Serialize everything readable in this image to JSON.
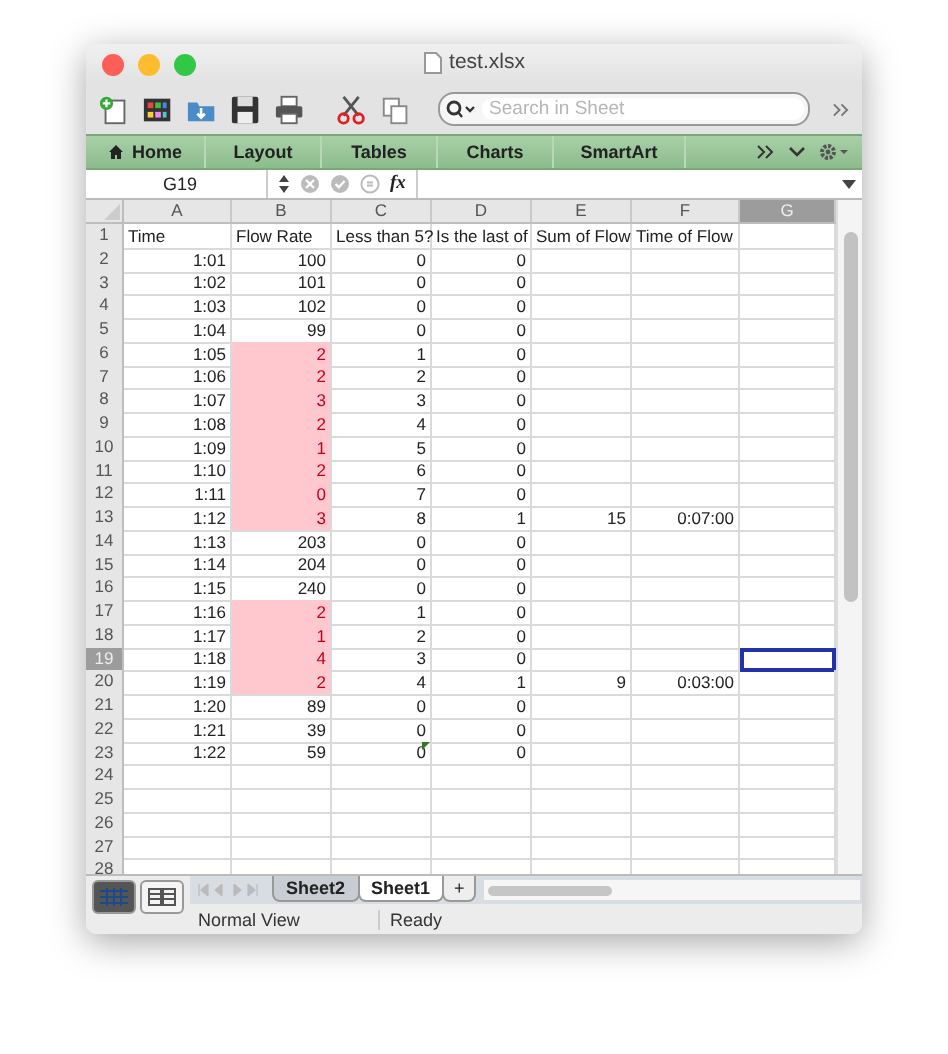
{
  "window": {
    "title": "test.xlsx"
  },
  "toolbar": {
    "search": {
      "placeholder": "Search in Sheet"
    }
  },
  "ribbon_tabs": [
    {
      "label": "Home",
      "kind": "home"
    },
    {
      "label": "Layout",
      "kind": "plain"
    },
    {
      "label": "Tables",
      "kind": "plain"
    },
    {
      "label": "Charts",
      "kind": "plain"
    },
    {
      "label": "SmartArt",
      "kind": "plain"
    }
  ],
  "formula_bar": {
    "name_box": "G19",
    "fx": "fx"
  },
  "columns": [
    {
      "label": "A",
      "selected": false
    },
    {
      "label": "B",
      "selected": false
    },
    {
      "label": "C",
      "selected": false
    },
    {
      "label": "D",
      "selected": false
    },
    {
      "label": "E",
      "selected": false
    },
    {
      "label": "F",
      "selected": false
    },
    {
      "label": "G",
      "selected": true
    }
  ],
  "rows": [
    {
      "number": "1",
      "kind": "text",
      "cells": [
        "Time",
        "Flow Rate",
        "Less than 5?",
        "Is the last of",
        "Sum of Flow",
        "Time of Flow"
      ],
      "flagged": false,
      "warning": false,
      "selected": false
    },
    {
      "number": "2",
      "kind": "number",
      "cells": [
        "1:01",
        "100",
        "0",
        "0"
      ],
      "flagged": false,
      "warning": false,
      "selected": false
    },
    {
      "number": "3",
      "kind": "number",
      "cells": [
        "1:02",
        "101",
        "0",
        "0"
      ],
      "flagged": false,
      "warning": false,
      "selected": false
    },
    {
      "number": "4",
      "kind": "number",
      "cells": [
        "1:03",
        "102",
        "0",
        "0"
      ],
      "flagged": false,
      "warning": false,
      "selected": false
    },
    {
      "number": "5",
      "kind": "number",
      "cells": [
        "1:04",
        "99",
        "0",
        "0"
      ],
      "flagged": false,
      "warning": false,
      "selected": false
    },
    {
      "number": "6",
      "kind": "number",
      "cells": [
        "1:05",
        "2",
        "1",
        "0"
      ],
      "flagged": true,
      "warning": false,
      "selected": false
    },
    {
      "number": "7",
      "kind": "number",
      "cells": [
        "1:06",
        "2",
        "2",
        "0"
      ],
      "flagged": true,
      "warning": false,
      "selected": false
    },
    {
      "number": "8",
      "kind": "number",
      "cells": [
        "1:07",
        "3",
        "3",
        "0"
      ],
      "flagged": true,
      "warning": false,
      "selected": false
    },
    {
      "number": "9",
      "kind": "number",
      "cells": [
        "1:08",
        "2",
        "4",
        "0"
      ],
      "flagged": true,
      "warning": false,
      "selected": false
    },
    {
      "number": "10",
      "kind": "number",
      "cells": [
        "1:09",
        "1",
        "5",
        "0"
      ],
      "flagged": true,
      "warning": false,
      "selected": false
    },
    {
      "number": "11",
      "kind": "number",
      "cells": [
        "1:10",
        "2",
        "6",
        "0"
      ],
      "flagged": true,
      "warning": false,
      "selected": false
    },
    {
      "number": "12",
      "kind": "number",
      "cells": [
        "1:11",
        "0",
        "7",
        "0"
      ],
      "flagged": true,
      "warning": false,
      "selected": false
    },
    {
      "number": "13",
      "kind": "number",
      "cells": [
        "1:12",
        "3",
        "8",
        "1",
        "15",
        "0:07:00"
      ],
      "flagged": true,
      "warning": false,
      "selected": false
    },
    {
      "number": "14",
      "kind": "number",
      "cells": [
        "1:13",
        "203",
        "0",
        "0"
      ],
      "flagged": false,
      "warning": false,
      "selected": false
    },
    {
      "number": "15",
      "kind": "number",
      "cells": [
        "1:14",
        "204",
        "0",
        "0"
      ],
      "flagged": false,
      "warning": false,
      "selected": false
    },
    {
      "number": "16",
      "kind": "number",
      "cells": [
        "1:15",
        "240",
        "0",
        "0"
      ],
      "flagged": false,
      "warning": false,
      "selected": false
    },
    {
      "number": "17",
      "kind": "number",
      "cells": [
        "1:16",
        "2",
        "1",
        "0"
      ],
      "flagged": true,
      "warning": false,
      "selected": false
    },
    {
      "number": "18",
      "kind": "number",
      "cells": [
        "1:17",
        "1",
        "2",
        "0"
      ],
      "flagged": true,
      "warning": false,
      "selected": false
    },
    {
      "number": "19",
      "kind": "number",
      "cells": [
        "1:18",
        "4",
        "3",
        "0"
      ],
      "flagged": true,
      "warning": false,
      "selected": true
    },
    {
      "number": "20",
      "kind": "number",
      "cells": [
        "1:19",
        "2",
        "4",
        "1",
        "9",
        "0:03:00"
      ],
      "flagged": true,
      "warning": false,
      "selected": false
    },
    {
      "number": "21",
      "kind": "number",
      "cells": [
        "1:20",
        "89",
        "0",
        "0"
      ],
      "flagged": false,
      "warning": false,
      "selected": false
    },
    {
      "number": "22",
      "kind": "number",
      "cells": [
        "1:21",
        "39",
        "0",
        "0"
      ],
      "flagged": false,
      "warning": false,
      "selected": false
    },
    {
      "number": "23",
      "kind": "number",
      "cells": [
        "1:22",
        "59",
        "0",
        "0"
      ],
      "flagged": false,
      "warning": true,
      "selected": false
    },
    {
      "number": "24",
      "kind": "number",
      "flagged": false,
      "warning": false,
      "selected": false
    },
    {
      "number": "25",
      "kind": "number",
      "flagged": false,
      "warning": false,
      "selected": false
    },
    {
      "number": "26",
      "kind": "number",
      "flagged": false,
      "warning": false,
      "selected": false
    },
    {
      "number": "27",
      "kind": "number",
      "flagged": false,
      "warning": false,
      "selected": false
    },
    {
      "number": "28",
      "kind": "number",
      "flagged": false,
      "warning": false,
      "selected": false
    }
  ],
  "view_buttons": [
    {
      "kind": "normal",
      "selected": true
    },
    {
      "kind": "page_layout",
      "selected": false
    }
  ],
  "sheet_tabs": [
    {
      "label": "Sheet2",
      "selected": false
    },
    {
      "label": "Sheet1",
      "selected": true
    }
  ],
  "add_sheet": "+",
  "status_bar": {
    "view": "Normal View",
    "state": "Ready"
  }
}
